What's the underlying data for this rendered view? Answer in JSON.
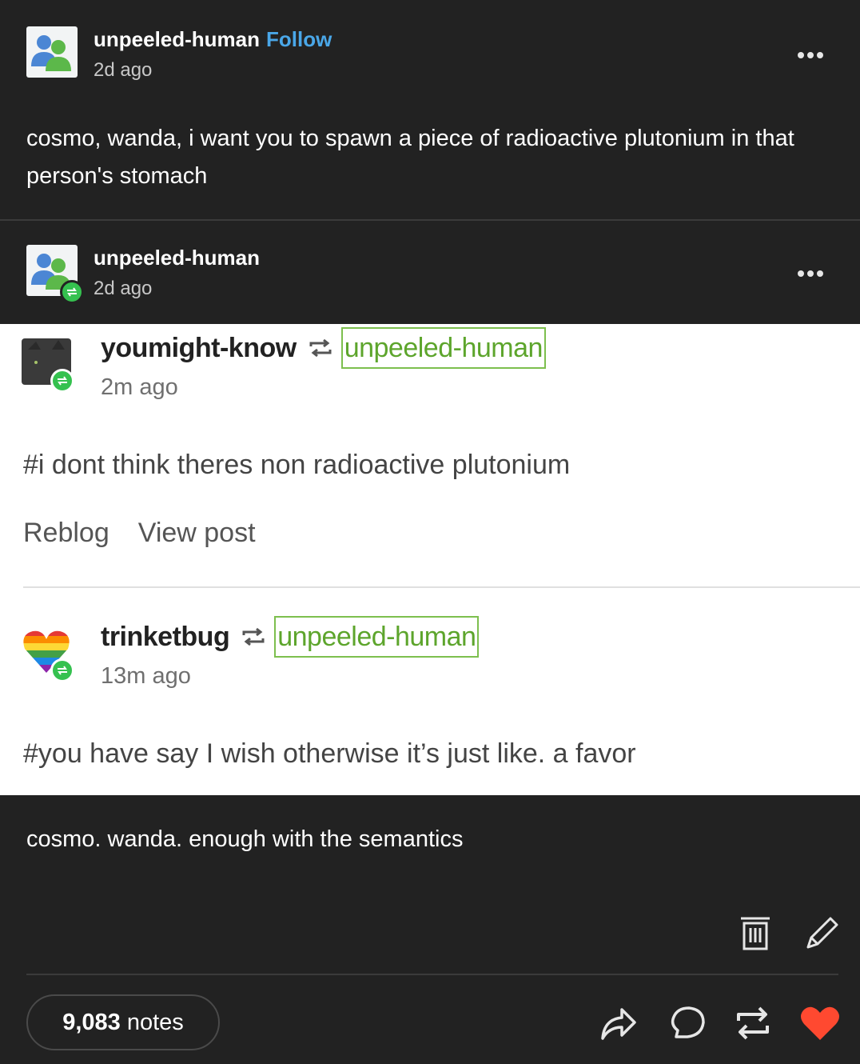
{
  "original_post": {
    "username": "unpeeled-human",
    "follow_label": "Follow",
    "timestamp": "2d ago",
    "text": "cosmo, wanda, i want you to spawn a piece of radioactive plutonium in that person's stomach"
  },
  "reblog_post": {
    "username": "unpeeled-human",
    "timestamp": "2d ago"
  },
  "notes_screenshot": {
    "items": [
      {
        "username": "youmight-know",
        "reblogged_from": "unpeeled-human",
        "timestamp": "2m ago",
        "tags": "#i dont think theres non radioactive plutonium",
        "actions": [
          "Reblog",
          "View post"
        ]
      },
      {
        "username": "trinketbug",
        "reblogged_from": "unpeeled-human",
        "timestamp": "13m ago",
        "tags": "#you have say I wish otherwise it’s just like. a favor"
      }
    ]
  },
  "reblog_text": "cosmo. wanda. enough with the semantics",
  "footer": {
    "notes_count": "9,083",
    "notes_label": "notes",
    "icons": [
      "trash-icon",
      "edit-icon",
      "share-icon",
      "reply-icon",
      "reblog-icon",
      "like-icon"
    ],
    "like_color": "#ff4930"
  },
  "colors": {
    "background": "#222222",
    "follow": "#4aa7e8",
    "reblog_badge": "#35c14f",
    "highlight_box": "#7dbf4e"
  }
}
